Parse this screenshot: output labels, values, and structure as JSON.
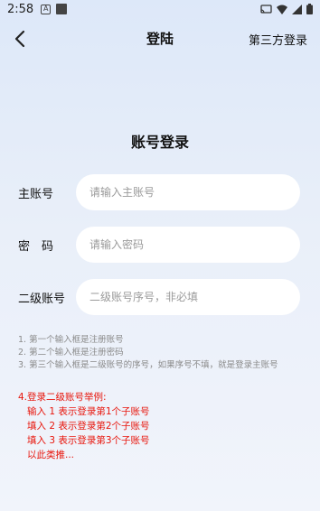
{
  "status_bar": {
    "time": "2:58",
    "notification_letter": "A"
  },
  "nav": {
    "title": "登陆",
    "third_party_login": "第三方登录"
  },
  "login_title": "账号登录",
  "form": {
    "main_account": {
      "label": "主账号",
      "placeholder": "请输入主账号",
      "value": ""
    },
    "password": {
      "label": "密　码",
      "placeholder": "请输入密码",
      "value": ""
    },
    "sub_account": {
      "label": "二级账号",
      "placeholder": "二级账号序号，非必填",
      "value": ""
    }
  },
  "notes": [
    "1. 第一个输入框是注册账号",
    "2. 第二个输入框是注册密码",
    "3. 第三个输入框是二级账号的序号，如果序号不填，就是登录主账号"
  ],
  "example": {
    "title": "4.登录二级账号举例:",
    "lines": [
      "输入 1 表示登录第1个子账号",
      "填入 2 表示登录第2个子账号",
      "填入 3 表示登录第3个子账号",
      "以此类推..."
    ]
  },
  "colors": {
    "accent_red": "#e8160c",
    "note_gray": "#8a8a8a",
    "input_bg": "#ffffff"
  }
}
